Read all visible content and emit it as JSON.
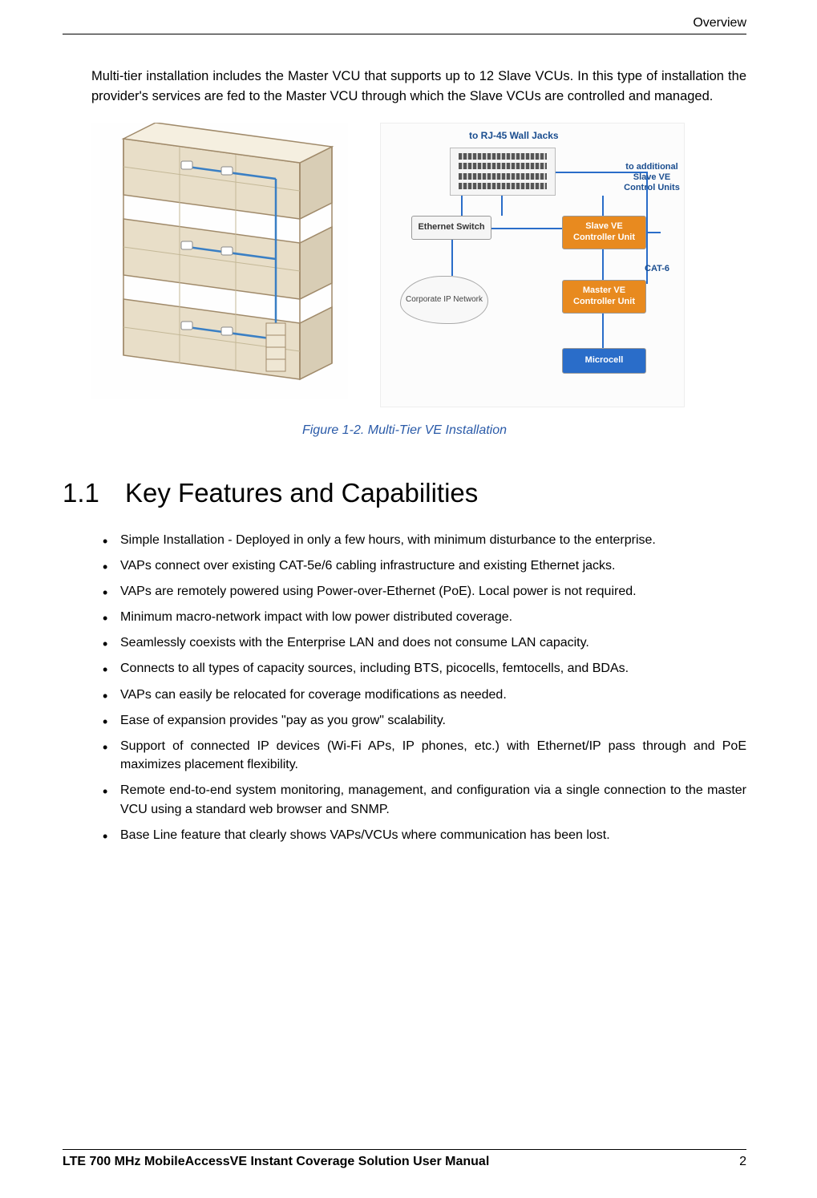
{
  "header": {
    "section": "Overview"
  },
  "intro": "Multi-tier installation includes the Master VCU that supports up to 12 Slave VCUs. In this type of installation the provider's services are fed to the Master VCU through which the Slave VCUs are controlled and managed.",
  "figure": {
    "caption": "Figure 1-2. Multi-Tier VE Installation",
    "diagram": {
      "top_label": "to RJ-45 Wall Jacks",
      "ethernet_switch": "Ethernet Switch",
      "slave_vcu": "Slave VE Controller Unit",
      "master_vcu": "Master VE Controller Unit",
      "microcell": "Microcell",
      "cloud": "Corporate IP Network",
      "side_add": "to additional Slave VE Control Units",
      "cat6": "CAT-6"
    }
  },
  "section": {
    "number": "1.1",
    "title": "Key Features and Capabilities",
    "bullets": [
      "Simple Installation - Deployed in only a few hours, with minimum disturbance to the enterprise.",
      "VAPs connect over existing CAT-5e/6 cabling infrastructure and existing Ethernet jacks.",
      "VAPs are remotely powered using Power-over-Ethernet (PoE). Local power is not required.",
      "Minimum macro-network impact with low power distributed coverage.",
      "Seamlessly coexists with the Enterprise LAN and does not consume LAN capacity.",
      "Connects to all types of capacity sources, including BTS, picocells, femtocells, and BDAs.",
      "VAPs can easily be relocated for coverage modifications as needed.",
      "Ease of expansion provides \"pay as you grow\" scalability.",
      "Support of connected IP devices (Wi-Fi APs, IP phones, etc.) with Ethernet/IP pass through and PoE maximizes placement flexibility.",
      "Remote end-to-end system monitoring, management, and configuration via a single connection to the master VCU using a standard web browser and SNMP.",
      "Base Line feature that clearly shows VAPs/VCUs where communication has been lost."
    ]
  },
  "footer": {
    "title": "LTE 700 MHz MobileAccessVE Instant Coverage Solution User Manual",
    "page": "2"
  }
}
